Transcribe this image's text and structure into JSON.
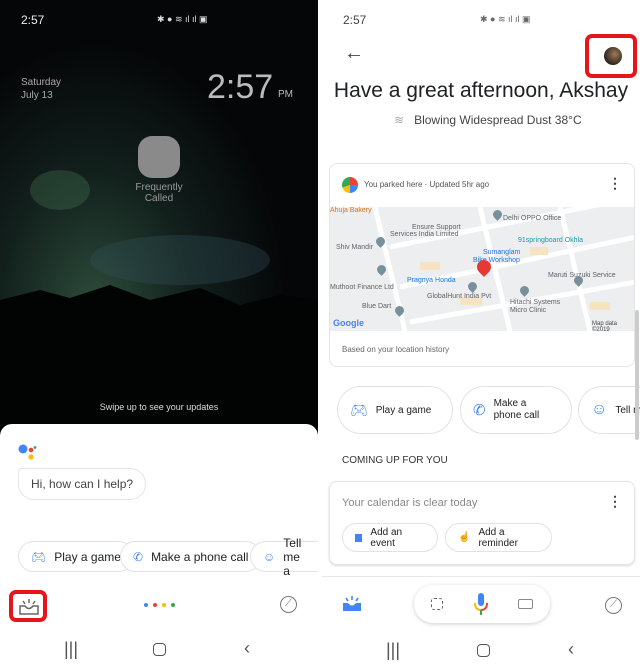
{
  "left": {
    "status": {
      "time": "2:57"
    },
    "lock": {
      "day": "Saturday",
      "date": "July 13",
      "clock": "2:57",
      "ampm": "PM"
    },
    "folder": {
      "label_line1": "Frequently",
      "label_line2": "Called"
    },
    "swipe_hint": "Swipe up to see your updates",
    "assistant": {
      "greeting": "Hi, how can I help?",
      "chips": [
        {
          "label": "Play a game",
          "icon": "gamepad-icon"
        },
        {
          "label": "Make a phone call",
          "icon": "phone-icon"
        },
        {
          "label": "Tell me a",
          "icon": "smiley-icon"
        }
      ],
      "dots_colors": [
        "#4285f4",
        "#ea4335",
        "#fbbc05",
        "#34a853"
      ]
    }
  },
  "right": {
    "status": {
      "time": "2:57"
    },
    "header": {
      "title": "Have a great afternoon, Akshay",
      "weather": "Blowing Widespread Dust 38°C"
    },
    "parking_card": {
      "title": "You parked here · Updated 5hr ago",
      "footer": "Based on your location history",
      "map": {
        "labels": [
          "Ahuja Bakery",
          "Delhi OPPO Office",
          "Ensure Support",
          "Services India Limited",
          "91springboard Okhla",
          "Shiv Mandir",
          "Sumanglam",
          "Bike Workshop",
          "Pragnya Honda",
          "Maruti Suzuki Service",
          "Muthoot Finance Ltd",
          "GlobalHunt India Pvt",
          "Blue Dart",
          "Hitachi Systems",
          "Micro Clinic"
        ],
        "logo": "Google",
        "attribution": "Map data ©2019"
      }
    },
    "chips": [
      {
        "label_line1": "Play a game",
        "label_line2": ""
      },
      {
        "label_line1": "Make a",
        "label_line2": "phone call"
      },
      {
        "label_line1": "Tell m",
        "label_line2": ""
      }
    ],
    "section_title": "COMING UP FOR YOU",
    "calendar_card": {
      "text": "Your calendar is clear today",
      "actions": [
        "Add an event",
        "Add a reminder"
      ]
    }
  },
  "colors": {
    "accent": "#4285f4",
    "highlight": "#e8141c"
  }
}
